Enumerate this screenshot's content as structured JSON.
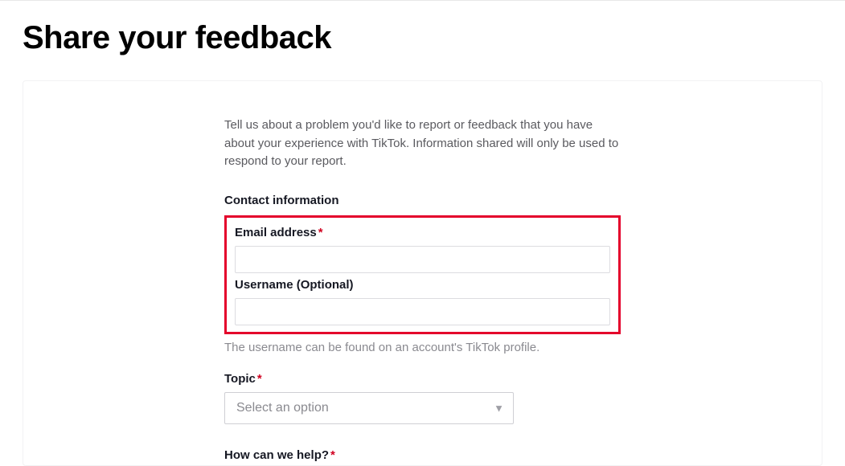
{
  "page": {
    "title": "Share your feedback",
    "intro": "Tell us about a problem you'd like to report or feedback that you have about your experience with TikTok. Information shared will only be used to respond to your report."
  },
  "sections": {
    "contact_heading": "Contact information",
    "username_hint": "The username can be found on an account's TikTok profile."
  },
  "fields": {
    "email": {
      "label": "Email address",
      "required_mark": "*",
      "value": ""
    },
    "username": {
      "label": "Username (Optional)",
      "value": ""
    },
    "topic": {
      "label": "Topic",
      "required_mark": "*",
      "placeholder": "Select an option"
    },
    "how_help": {
      "label": "How can we help?",
      "required_mark": "*"
    }
  }
}
